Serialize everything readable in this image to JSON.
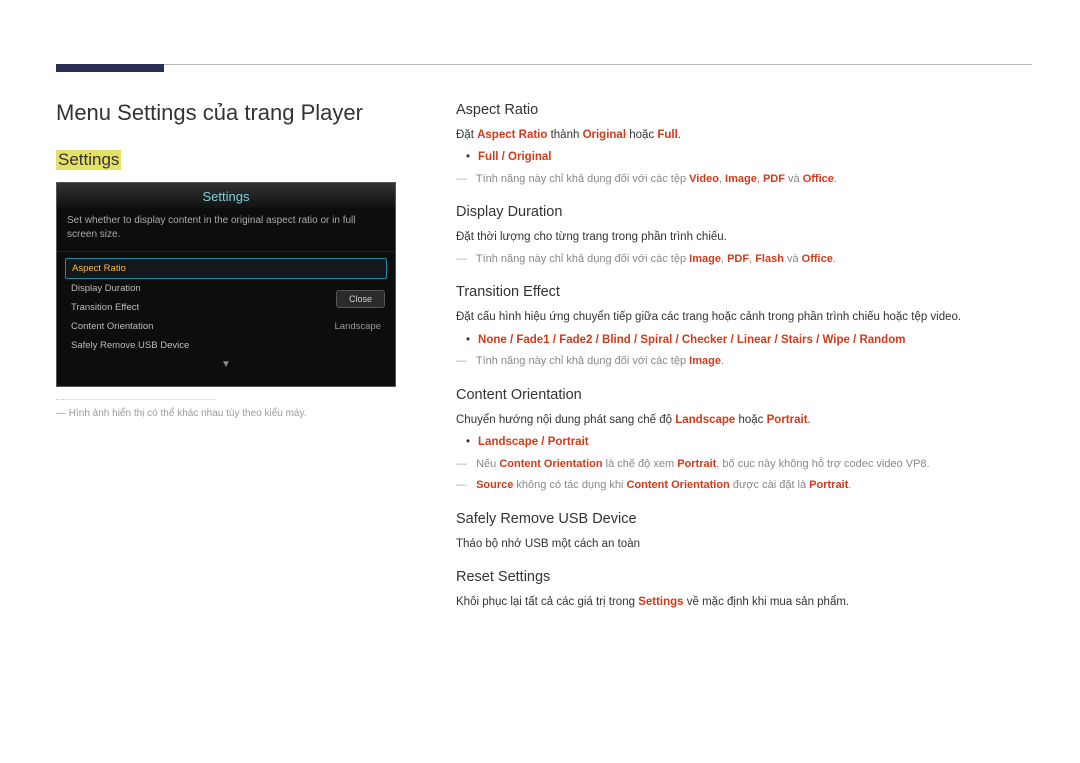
{
  "page": {
    "title": "Menu Settings của trang Player",
    "highlight_label": "Settings",
    "caption": "Hình ảnh hiển thị có thể khác nhau tùy theo kiểu máy."
  },
  "device": {
    "title": "Settings",
    "subtitle": "Set whether to display content in the original aspect ratio or in full screen size.",
    "items": [
      {
        "label": "Aspect Ratio",
        "value": ""
      },
      {
        "label": "Display Duration",
        "value": ""
      },
      {
        "label": "Transition Effect",
        "value": ""
      },
      {
        "label": "Content Orientation",
        "value": "Landscape"
      },
      {
        "label": "Safely Remove USB Device",
        "value": ""
      }
    ],
    "close_label": "Close"
  },
  "sections": {
    "aspect_ratio": {
      "heading": "Aspect Ratio",
      "line1_pre": "Đặt ",
      "line1_b1": "Aspect Ratio",
      "line1_mid": " thành ",
      "line1_b2": "Original",
      "line1_mid2": " hoặc ",
      "line1_b3": "Full",
      "line1_end": ".",
      "bullet": "Full / Original",
      "note_pre": "Tính năng này chỉ khả dụng đối với các tệp ",
      "note_b1": "Video",
      "note_s1": ", ",
      "note_b2": "Image",
      "note_s2": ", ",
      "note_b3": "PDF",
      "note_s3": " và ",
      "note_b4": "Office",
      "note_end": "."
    },
    "display_duration": {
      "heading": "Display Duration",
      "line1": "Đặt thời lượng cho từng trang trong phần trình chiếu.",
      "note_pre": "Tính năng này chỉ khả dụng đối với các tệp ",
      "note_b1": "Image",
      "note_s1": ", ",
      "note_b2": "PDF",
      "note_s2": ", ",
      "note_b3": "Flash",
      "note_s3": " và ",
      "note_b4": "Office",
      "note_end": "."
    },
    "transition": {
      "heading": "Transition Effect",
      "line1": "Đặt cấu hình hiệu ứng chuyển tiếp giữa các trang hoặc cảnh trong phần trình chiếu hoặc tệp video.",
      "bullet": "None / Fade1 / Fade2 / Blind / Spiral / Checker / Linear / Stairs / Wipe / Random",
      "note_pre": "Tính năng này chỉ khả dụng đối với các tệp ",
      "note_b1": "Image",
      "note_end": "."
    },
    "content_orientation": {
      "heading": "Content Orientation",
      "line1_pre": "Chuyển hướng nội dung phát sang chế độ ",
      "line1_b1": "Landscape",
      "line1_mid": " hoặc ",
      "line1_b2": "Portrait",
      "line1_end": ".",
      "bullet": "Landscape / Portrait",
      "note1_pre": "Nếu ",
      "note1_b1": "Content Orientation",
      "note1_mid": " là chế độ xem ",
      "note1_b2": "Portrait",
      "note1_end": ", bố cục này không hỗ trợ codec video VP8.",
      "note2_b1": "Source",
      "note2_mid": " không có tác dụng khi ",
      "note2_b2": "Content Orientation",
      "note2_mid2": " được cài đặt là ",
      "note2_b3": "Portrait",
      "note2_end": "."
    },
    "usb": {
      "heading": "Safely Remove USB Device",
      "line1": "Tháo bộ nhớ USB một cách an toàn"
    },
    "reset": {
      "heading": "Reset Settings",
      "line1_pre": "Khôi phục lại tất cả các giá trị trong ",
      "line1_b1": "Settings",
      "line1_end": " về mặc định khi mua sản phẩm."
    }
  }
}
